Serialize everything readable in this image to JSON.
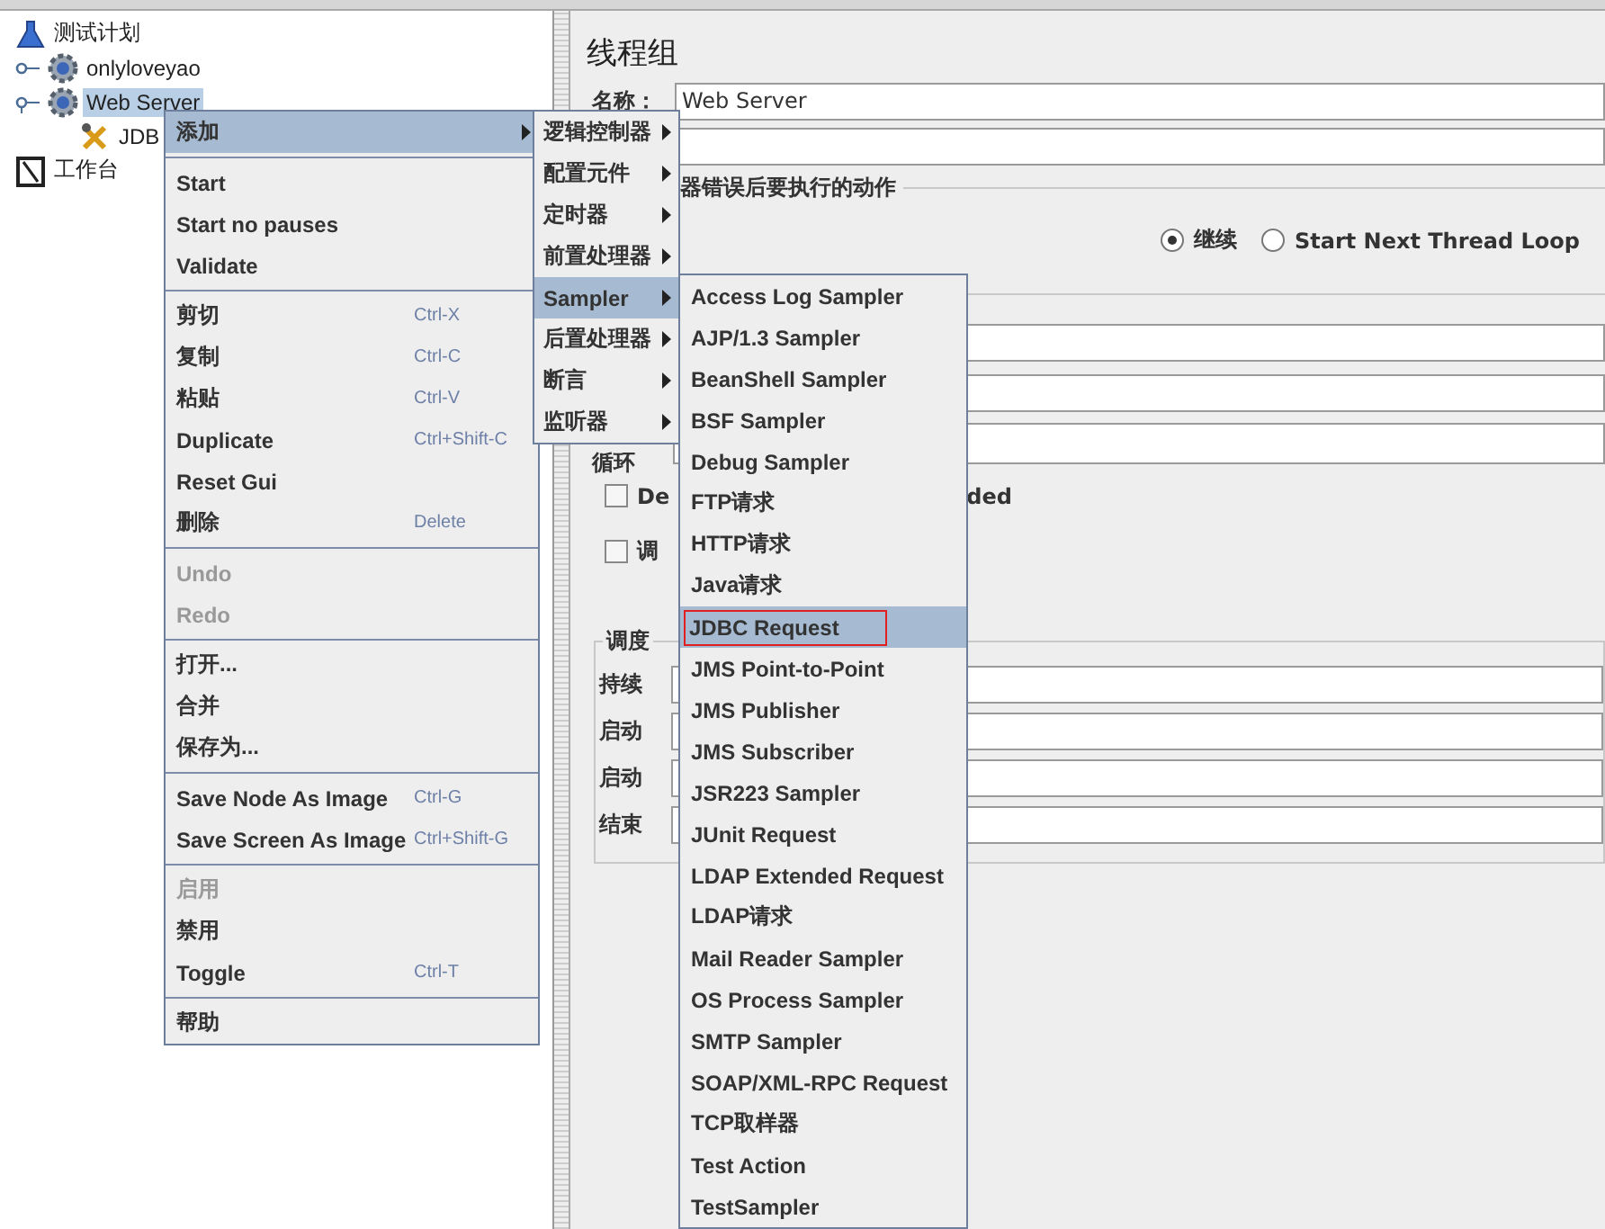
{
  "tree": [
    {
      "label": "测试计划",
      "kind": "test_plan",
      "selected": false,
      "children": [
        {
          "label": "onlyloveyao",
          "kind": "thread_group",
          "selected": false,
          "expanded": false
        },
        {
          "label": "Web Server",
          "kind": "thread_group",
          "selected": true,
          "expanded": true,
          "children": [
            {
              "label": "JDB",
              "kind": "sampler",
              "selected": false
            }
          ]
        }
      ]
    },
    {
      "label": "工作台",
      "kind": "workbench",
      "selected": false
    }
  ],
  "panel": {
    "title": "线程组",
    "name_label": "名称：",
    "name_value": "Web Server",
    "on_error": {
      "legend": "器错误后要执行的动作",
      "radios": [
        {
          "label": "继续",
          "selected": true
        },
        {
          "label": "Start Next Thread Loop",
          "selected": false
        }
      ]
    },
    "thread_props": {
      "loop_label": "循环",
      "checkboxes": [
        {
          "label": "De",
          "tail": "ded",
          "checked": false
        },
        {
          "label": "调",
          "checked": false
        }
      ]
    },
    "scheduler": {
      "legend": "调度",
      "rows": [
        "持续",
        "启动",
        "启动",
        "结束"
      ]
    }
  },
  "context_menu": {
    "groups": [
      [
        {
          "label": "添加",
          "selected": true,
          "disabled": false,
          "has_submenu": true
        }
      ],
      [
        {
          "label": "Start",
          "selected": false,
          "disabled": false
        },
        {
          "label": "Start no pauses",
          "selected": false,
          "disabled": false
        },
        {
          "label": "Validate",
          "selected": false,
          "disabled": false
        }
      ],
      [
        {
          "label": "剪切",
          "shortcut": "Ctrl-X",
          "selected": false,
          "disabled": false
        },
        {
          "label": "复制",
          "shortcut": "Ctrl-C",
          "selected": false,
          "disabled": false
        },
        {
          "label": "粘贴",
          "shortcut": "Ctrl-V",
          "selected": false,
          "disabled": false
        },
        {
          "label": "Duplicate",
          "shortcut": "Ctrl+Shift-C",
          "selected": false,
          "disabled": false
        },
        {
          "label": "Reset Gui",
          "selected": false,
          "disabled": false
        },
        {
          "label": "删除",
          "shortcut": "Delete",
          "selected": false,
          "disabled": false
        }
      ],
      [
        {
          "label": "Undo",
          "selected": false,
          "disabled": true
        },
        {
          "label": "Redo",
          "selected": false,
          "disabled": true
        }
      ],
      [
        {
          "label": "打开...",
          "selected": false,
          "disabled": false
        },
        {
          "label": "合并",
          "selected": false,
          "disabled": false
        },
        {
          "label": "保存为...",
          "selected": false,
          "disabled": false
        }
      ],
      [
        {
          "label": "Save Node As Image",
          "shortcut": "Ctrl-G",
          "selected": false,
          "disabled": false
        },
        {
          "label": "Save Screen As Image",
          "shortcut": "Ctrl+Shift-G",
          "selected": false,
          "disabled": false
        }
      ],
      [
        {
          "label": "启用",
          "selected": false,
          "disabled": true
        },
        {
          "label": "禁用",
          "selected": false,
          "disabled": false
        },
        {
          "label": "Toggle",
          "shortcut": "Ctrl-T",
          "selected": false,
          "disabled": false
        }
      ],
      [
        {
          "label": "帮助",
          "selected": false,
          "disabled": false
        }
      ]
    ]
  },
  "add_submenu": [
    {
      "label": "逻辑控制器",
      "selected": false
    },
    {
      "label": "配置元件",
      "selected": false
    },
    {
      "label": "定时器",
      "selected": false
    },
    {
      "label": "前置处理器",
      "selected": false
    },
    {
      "label": "Sampler",
      "selected": true
    },
    {
      "label": "后置处理器",
      "selected": false
    },
    {
      "label": "断言",
      "selected": false
    },
    {
      "label": "监听器",
      "selected": false
    }
  ],
  "sampler_submenu": [
    {
      "label": "Access Log Sampler",
      "selected": false,
      "outlined": false
    },
    {
      "label": "AJP/1.3 Sampler",
      "selected": false,
      "outlined": false
    },
    {
      "label": "BeanShell Sampler",
      "selected": false,
      "outlined": false
    },
    {
      "label": "BSF Sampler",
      "selected": false,
      "outlined": false
    },
    {
      "label": "Debug Sampler",
      "selected": false,
      "outlined": false
    },
    {
      "label": "FTP请求",
      "selected": false,
      "outlined": false
    },
    {
      "label": "HTTP请求",
      "selected": false,
      "outlined": false
    },
    {
      "label": "Java请求",
      "selected": false,
      "outlined": false
    },
    {
      "label": "JDBC Request",
      "selected": true,
      "outlined": true
    },
    {
      "label": "JMS Point-to-Point",
      "selected": false,
      "outlined": false
    },
    {
      "label": "JMS Publisher",
      "selected": false,
      "outlined": false
    },
    {
      "label": "JMS Subscriber",
      "selected": false,
      "outlined": false
    },
    {
      "label": "JSR223 Sampler",
      "selected": false,
      "outlined": false
    },
    {
      "label": "JUnit Request",
      "selected": false,
      "outlined": false
    },
    {
      "label": "LDAP Extended Request",
      "selected": false,
      "outlined": false
    },
    {
      "label": "LDAP请求",
      "selected": false,
      "outlined": false
    },
    {
      "label": "Mail Reader Sampler",
      "selected": false,
      "outlined": false
    },
    {
      "label": "OS Process Sampler",
      "selected": false,
      "outlined": false
    },
    {
      "label": "SMTP Sampler",
      "selected": false,
      "outlined": false
    },
    {
      "label": "SOAP/XML-RPC Request",
      "selected": false,
      "outlined": false
    },
    {
      "label": "TCP取样器",
      "selected": false,
      "outlined": false
    },
    {
      "label": "Test Action",
      "selected": false,
      "outlined": false
    },
    {
      "label": "TestSampler",
      "selected": false,
      "outlined": false
    }
  ]
}
